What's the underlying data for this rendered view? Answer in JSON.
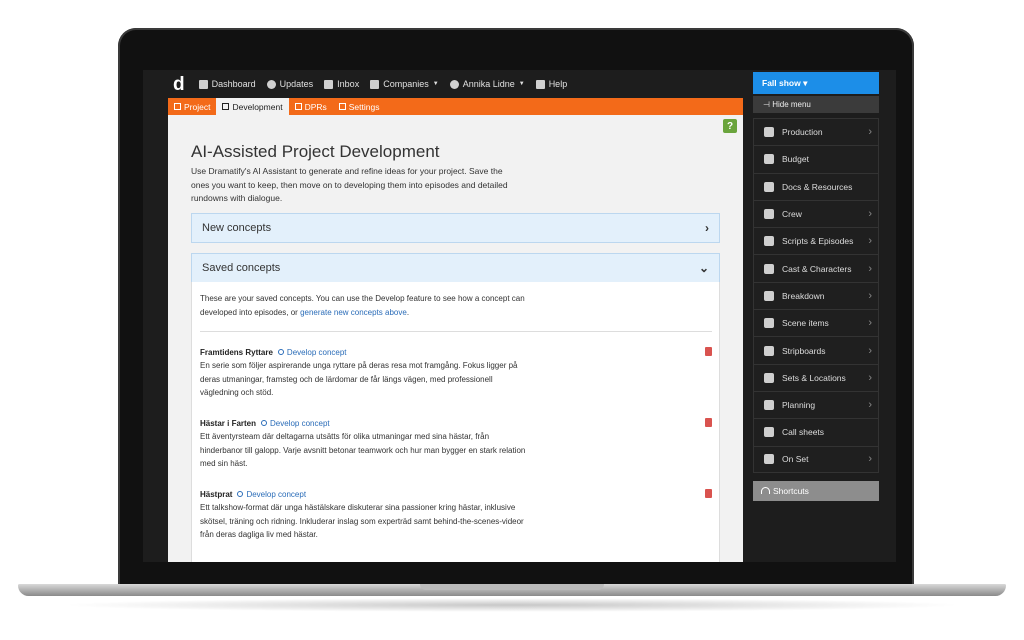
{
  "topnav": {
    "logo": "d",
    "items": [
      {
        "label": "Dashboard",
        "icon": "dashboard-icon"
      },
      {
        "label": "Updates",
        "icon": "info-icon"
      },
      {
        "label": "Inbox",
        "icon": "inbox-icon"
      },
      {
        "label": "Companies",
        "icon": "briefcase-icon",
        "caret": "▼"
      },
      {
        "label": "Annika Lidne",
        "icon": "user-icon",
        "caret": "▼"
      },
      {
        "label": "Help",
        "icon": "help-icon"
      }
    ]
  },
  "tabs": [
    {
      "label": "Project",
      "active": false
    },
    {
      "label": "Development",
      "active": true
    },
    {
      "label": "DPRs",
      "active": false
    },
    {
      "label": "Settings",
      "active": false
    }
  ],
  "main": {
    "help_label": "?",
    "title": "AI-Assisted Project Development",
    "intro": "Use Dramatify's AI Assistant to generate and refine ideas for your project. Save the ones you want to keep, then move on to developing them into episodes and detailed rundowns with dialogue.",
    "new_concepts": {
      "label": "New concepts",
      "chevron": "›"
    },
    "saved_concepts": {
      "label": "Saved concepts",
      "chevron": "⌄"
    },
    "saved_intro_text": "These are your saved concepts. You can use the Develop feature to see how a concept can developed into episodes, or ",
    "saved_intro_link": "generate new concepts above",
    "saved_intro_end": ".",
    "develop_label": "Develop concept",
    "concepts": [
      {
        "title": "Framtidens Ryttare",
        "description": "En serie som följer aspirerande unga ryttare på deras resa mot framgång. Fokus ligger på deras utmaningar, framsteg och de lärdomar de får längs vägen, med professionell vägledning och stöd."
      },
      {
        "title": "Hästar i Farten",
        "description": "Ett äventyrsteam där deltagarna utsätts för olika utmaningar med sina hästar, från hinderbanor till galopp. Varje avsnitt betonar teamwork och hur man bygger en stark relation med sin häst."
      },
      {
        "title": "Hästprat",
        "description": "Ett talkshow-format där unga hästälskare diskuterar sina passioner kring hästar, inklusive skötsel, träning och ridning. Inkluderar inslag som experträd samt behind-the-scenes-videor från deras dagliga liv med hästar."
      }
    ]
  },
  "sidebar": {
    "show_label": "Fall show ▾",
    "hide_menu": "⊣ Hide menu",
    "items": [
      {
        "label": "Production",
        "icon": "film-icon",
        "arrow": true
      },
      {
        "label": "Budget",
        "icon": "dollar-icon",
        "arrow": false
      },
      {
        "label": "Docs & Resources",
        "icon": "document-icon",
        "arrow": false
      },
      {
        "label": "Crew",
        "icon": "crew-icon",
        "arrow": true
      },
      {
        "label": "Scripts & Episodes",
        "icon": "script-icon",
        "arrow": true
      },
      {
        "label": "Cast & Characters",
        "icon": "mask-icon",
        "arrow": true
      },
      {
        "label": "Breakdown",
        "icon": "breakdown-icon",
        "arrow": true
      },
      {
        "label": "Scene items",
        "icon": "scene-items-icon",
        "arrow": true
      },
      {
        "label": "Stripboards",
        "icon": "stripboard-icon",
        "arrow": true
      },
      {
        "label": "Sets & Locations",
        "icon": "location-icon",
        "arrow": true
      },
      {
        "label": "Planning",
        "icon": "calendar-icon",
        "arrow": true
      },
      {
        "label": "Call sheets",
        "icon": "megaphone-icon",
        "arrow": false
      },
      {
        "label": "On Set",
        "icon": "on-set-icon",
        "arrow": true
      }
    ],
    "shortcuts": "Shortcuts"
  },
  "colors": {
    "accent_orange": "#f36a19",
    "sidebar_blue": "#1c8ee8",
    "link_blue": "#2a6cb8",
    "help_green": "#6aa43c",
    "trash_red": "#d9534f"
  }
}
